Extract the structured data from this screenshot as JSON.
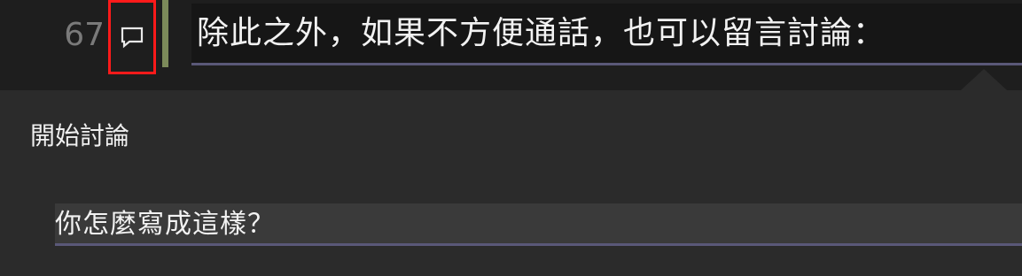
{
  "editor": {
    "line_number": "67",
    "line_text": "除此之外，如果不方便通話，也可以留言討論：",
    "comment_icon": "comment-icon"
  },
  "discussion": {
    "title": "開始討論",
    "input_value": "你怎麼寫成這樣？"
  },
  "colors": {
    "highlight_border": "#ff1a1a",
    "underline": "#5a5878",
    "gutter_bar": "#7c8a5a"
  }
}
